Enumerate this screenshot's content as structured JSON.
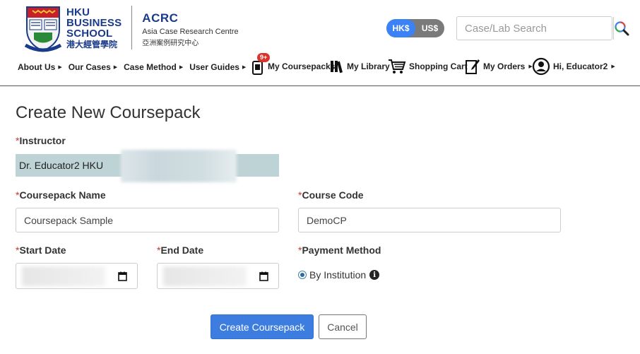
{
  "brand": {
    "school_line1": "HKU",
    "school_line2": "BUSINESS",
    "school_line3": "SCHOOL",
    "school_chinese": "港大經管學院",
    "acrc_title": "ACRC",
    "acrc_subtitle": "Asia Case Research Centre",
    "acrc_chinese": "亞洲案例研究中心"
  },
  "currency": {
    "options": [
      "HK$",
      "US$"
    ],
    "selected": "HK$"
  },
  "search": {
    "placeholder": "Case/Lab Search",
    "value": ""
  },
  "nav_left": [
    {
      "label": "About Us"
    },
    {
      "label": "Our Cases"
    },
    {
      "label": "Case Method"
    },
    {
      "label": "User Guides"
    }
  ],
  "nav_right": {
    "coursepacks": {
      "label": "My Coursepacks",
      "badge": "9+",
      "icon": "coursepack-icon"
    },
    "library": {
      "label": "My Library",
      "icon": "library-icon"
    },
    "cart": {
      "label": "Shopping Cart",
      "icon": "cart-icon"
    },
    "orders": {
      "label": "My Orders",
      "icon": "orders-icon"
    },
    "user": {
      "label": "Hi, Educator2",
      "icon": "user-icon"
    }
  },
  "form": {
    "title": "Create New Coursepack",
    "required_marker": "*",
    "instructor_label": "Instructor",
    "instructor_value": "Dr. Educator2 HKU",
    "coursepack_name_label": "Coursepack Name",
    "coursepack_name_value": "Coursepack Sample",
    "course_code_label": "Course Code",
    "course_code_value": "DemoCP",
    "start_date_label": "Start Date",
    "end_date_label": "End Date",
    "payment_method_label": "Payment Method",
    "payment_option": "By Institution",
    "create_button": "Create Coursepack",
    "cancel_button": "Cancel"
  },
  "colors": {
    "brand_blue": "#1a3a8a",
    "primary_button": "#3d7de0",
    "instructor_bg": "#bed3d6",
    "required": "#c0392b"
  }
}
